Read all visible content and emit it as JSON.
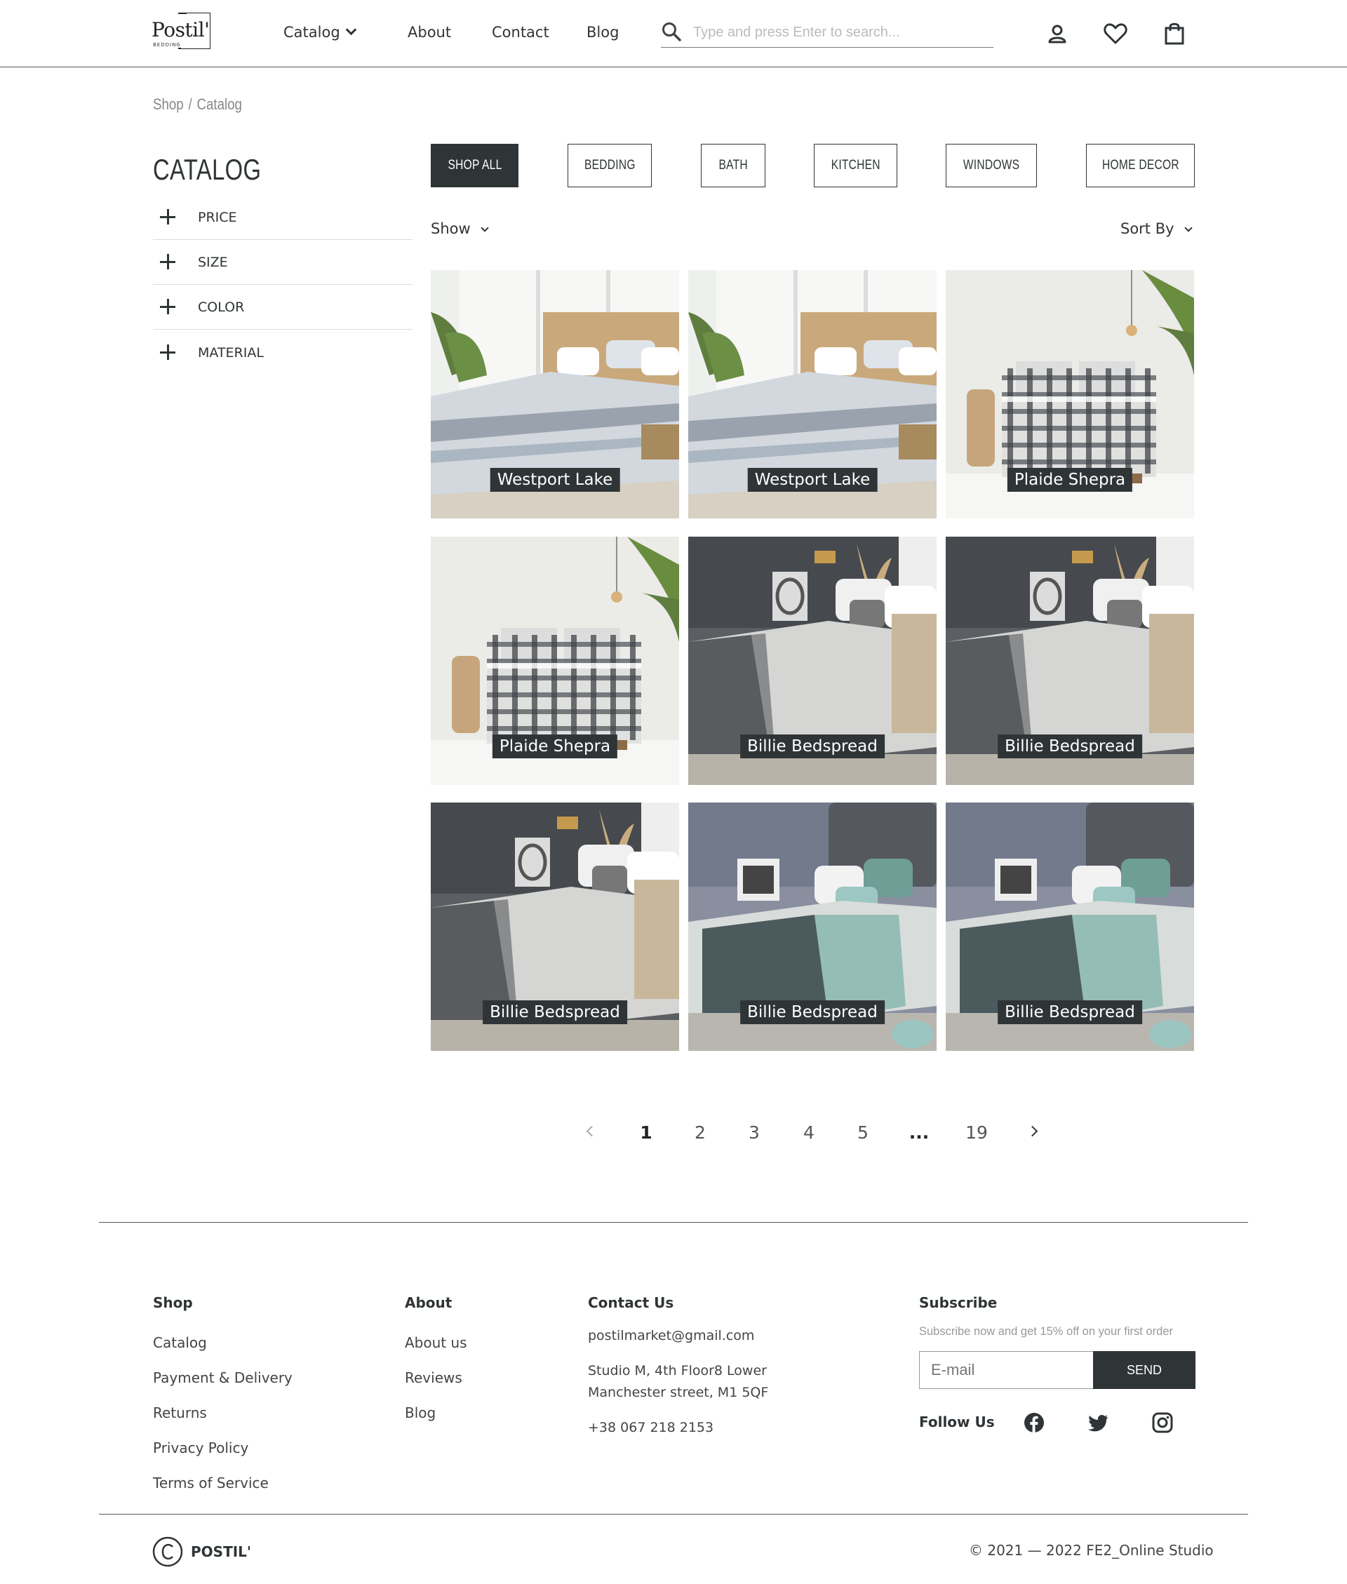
{
  "header": {
    "logo_text": "Postil'",
    "logo_sub": "BEDDING",
    "nav": {
      "catalog": "Catalog",
      "about": "About",
      "contact": "Contact",
      "blog": "Blog"
    },
    "search_placeholder": "Type and press Enter to search...",
    "icons": [
      "user-icon",
      "heart-icon",
      "shopping-bag-icon"
    ]
  },
  "breadcrumb": {
    "shop": "Shop",
    "separator": "/",
    "current": "Catalog"
  },
  "sidebar": {
    "title": "CATALOG",
    "filters": [
      "PRICE",
      "SIZE",
      "COLOR",
      "MATERIAL"
    ]
  },
  "tabs": [
    "SHOP ALL",
    "BEDDING",
    "BATH",
    "KITCHEN",
    "WINDOWS",
    "HOME DECOR"
  ],
  "active_tab": "SHOP ALL",
  "toolbar": {
    "show": "Show",
    "sort": "Sort By"
  },
  "products": [
    {
      "name": "Westport Lake",
      "style": "stripe"
    },
    {
      "name": "Westport Lake",
      "style": "stripe"
    },
    {
      "name": "Plaide Shepra",
      "style": "plaid"
    },
    {
      "name": "Plaide Shepra",
      "style": "plaid"
    },
    {
      "name": "Billie Bedspread",
      "style": "billie"
    },
    {
      "name": "Billie Bedspread",
      "style": "billie"
    },
    {
      "name": "Billie Bedspread",
      "style": "billie"
    },
    {
      "name": "Billie Bedspread",
      "style": "teal"
    },
    {
      "name": "Billie Bedspread",
      "style": "teal"
    }
  ],
  "pagination": {
    "pages": [
      "1",
      "2",
      "3",
      "4",
      "5",
      "...",
      "19"
    ],
    "current": "1"
  },
  "footer": {
    "shop": {
      "title": "Shop",
      "links": [
        "Catalog",
        "Payment & Delivery",
        "Returns",
        "Privacy Policy",
        "Terms of Service"
      ]
    },
    "about": {
      "title": "About",
      "links": [
        "About us",
        "Reviews",
        "Blog"
      ]
    },
    "contact": {
      "title": "Contact Us",
      "email": "postilmarket@gmail.com",
      "address_line1": "Studio M, 4th Floor8 Lower",
      "address_line2": "Manchester street, M1 5QF",
      "phone": "+38 067 218 2153"
    },
    "subscribe": {
      "title": "Subscribe",
      "text": "Subscribe now and get 15% off on your first order",
      "email_placeholder": "E-mail",
      "send": "SEND",
      "follow": "Follow Us"
    },
    "brand": "POSTIL'",
    "copyright": "© 2021 — 2022 FE2_Online Studio"
  },
  "colors": {
    "dark": "#2f3436",
    "accent_text": "#ffffff"
  }
}
